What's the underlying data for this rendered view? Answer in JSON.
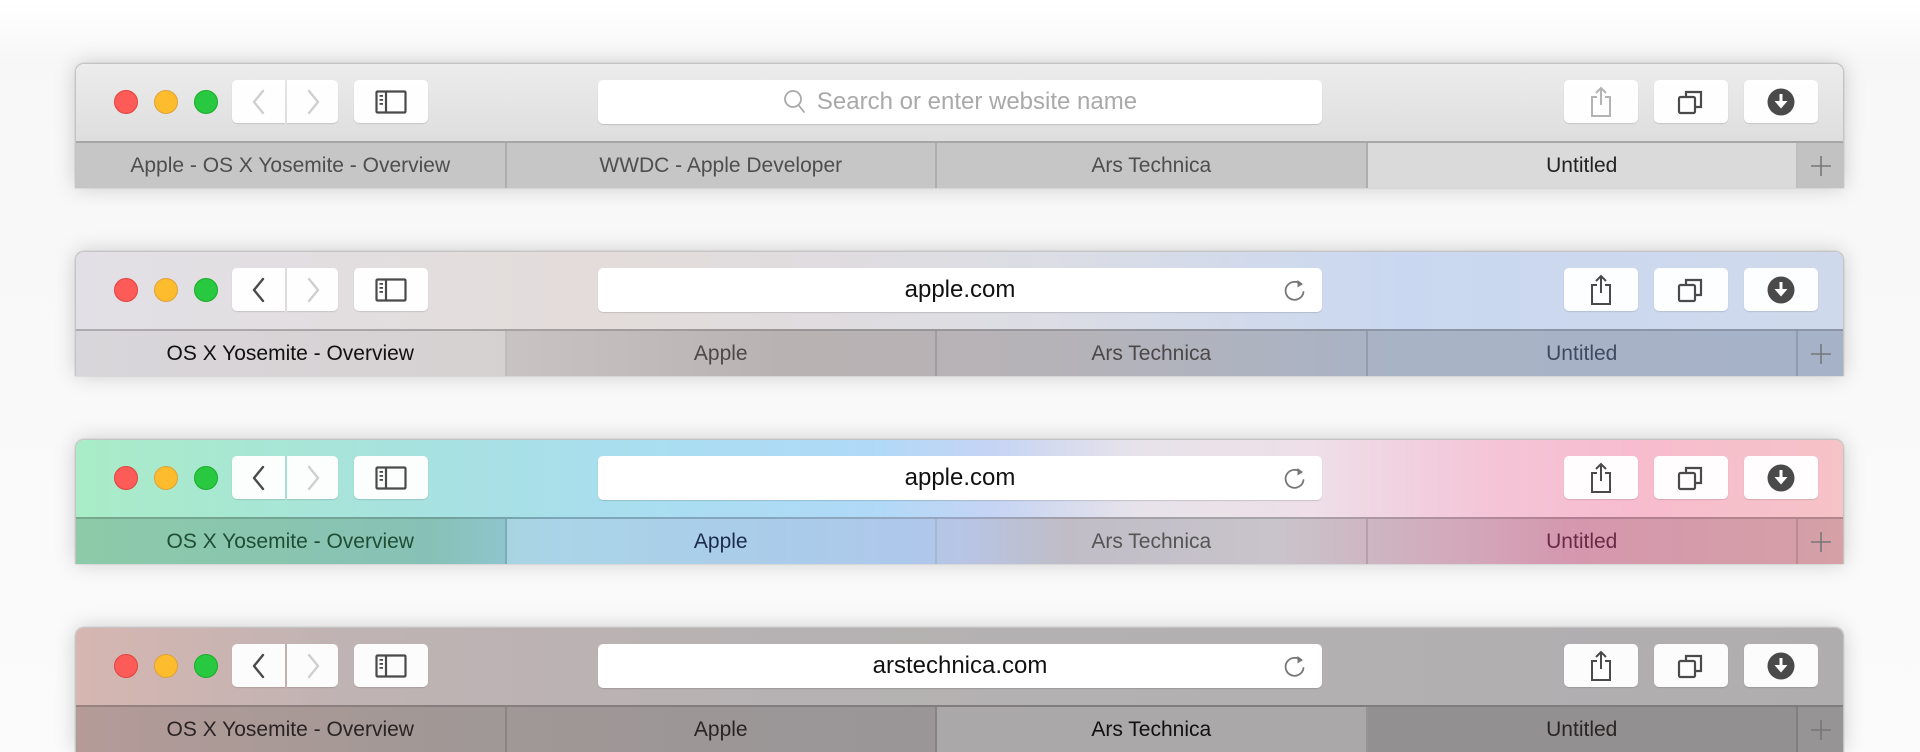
{
  "windows": [
    {
      "id": "w1",
      "address": {
        "value": "",
        "placeholder": "Search or enter website name",
        "show_reload": false
      },
      "back_enabled": false,
      "forward_enabled": false,
      "share_enabled": false,
      "tabs": [
        {
          "label": "Apple - OS X Yosemite - Overview",
          "active": false
        },
        {
          "label": "WWDC - Apple Developer",
          "active": false
        },
        {
          "label": "Ars Technica",
          "active": false
        },
        {
          "label": "Untitled",
          "active": true
        }
      ],
      "new_tab_label": "+"
    },
    {
      "id": "w2",
      "address": {
        "value": "apple.com",
        "placeholder": "",
        "show_reload": true
      },
      "back_enabled": true,
      "forward_enabled": false,
      "share_enabled": true,
      "tabs": [
        {
          "label": "OS X Yosemite - Overview",
          "active": true
        },
        {
          "label": "Apple",
          "active": false
        },
        {
          "label": "Ars Technica",
          "active": false
        },
        {
          "label": "Untitled",
          "active": false
        }
      ],
      "new_tab_label": "+"
    },
    {
      "id": "w3",
      "address": {
        "value": "apple.com",
        "placeholder": "",
        "show_reload": true
      },
      "back_enabled": true,
      "forward_enabled": false,
      "share_enabled": true,
      "tabs": [
        {
          "label": "OS X Yosemite - Overview",
          "active": false
        },
        {
          "label": "Apple",
          "active": true
        },
        {
          "label": "Ars Technica",
          "active": false
        },
        {
          "label": "Untitled",
          "active": false
        }
      ],
      "new_tab_label": "+"
    },
    {
      "id": "w4",
      "address": {
        "value": "arstechnica.com",
        "placeholder": "",
        "show_reload": true
      },
      "back_enabled": true,
      "forward_enabled": false,
      "share_enabled": true,
      "tabs": [
        {
          "label": "OS X Yosemite - Overview",
          "active": false
        },
        {
          "label": "Apple",
          "active": false
        },
        {
          "label": "Ars Technica",
          "active": true
        },
        {
          "label": "Untitled",
          "active": false
        }
      ],
      "new_tab_label": "+"
    }
  ],
  "icons": {
    "close": "close-icon",
    "minimize": "minimize-icon",
    "zoom": "zoom-icon",
    "back": "chevron-left-icon",
    "forward": "chevron-right-icon",
    "sidebar": "sidebar-icon",
    "search": "search-icon",
    "reload": "reload-icon",
    "share": "share-icon",
    "tabs": "tab-overview-icon",
    "download": "download-icon",
    "new_tab": "plus-icon"
  },
  "colors": {
    "close": "#fc5b57",
    "minimize": "#fdbc2e",
    "zoom": "#28c840",
    "icon_dark": "#4a4a4a",
    "icon_disabled": "#cfcfcf"
  }
}
